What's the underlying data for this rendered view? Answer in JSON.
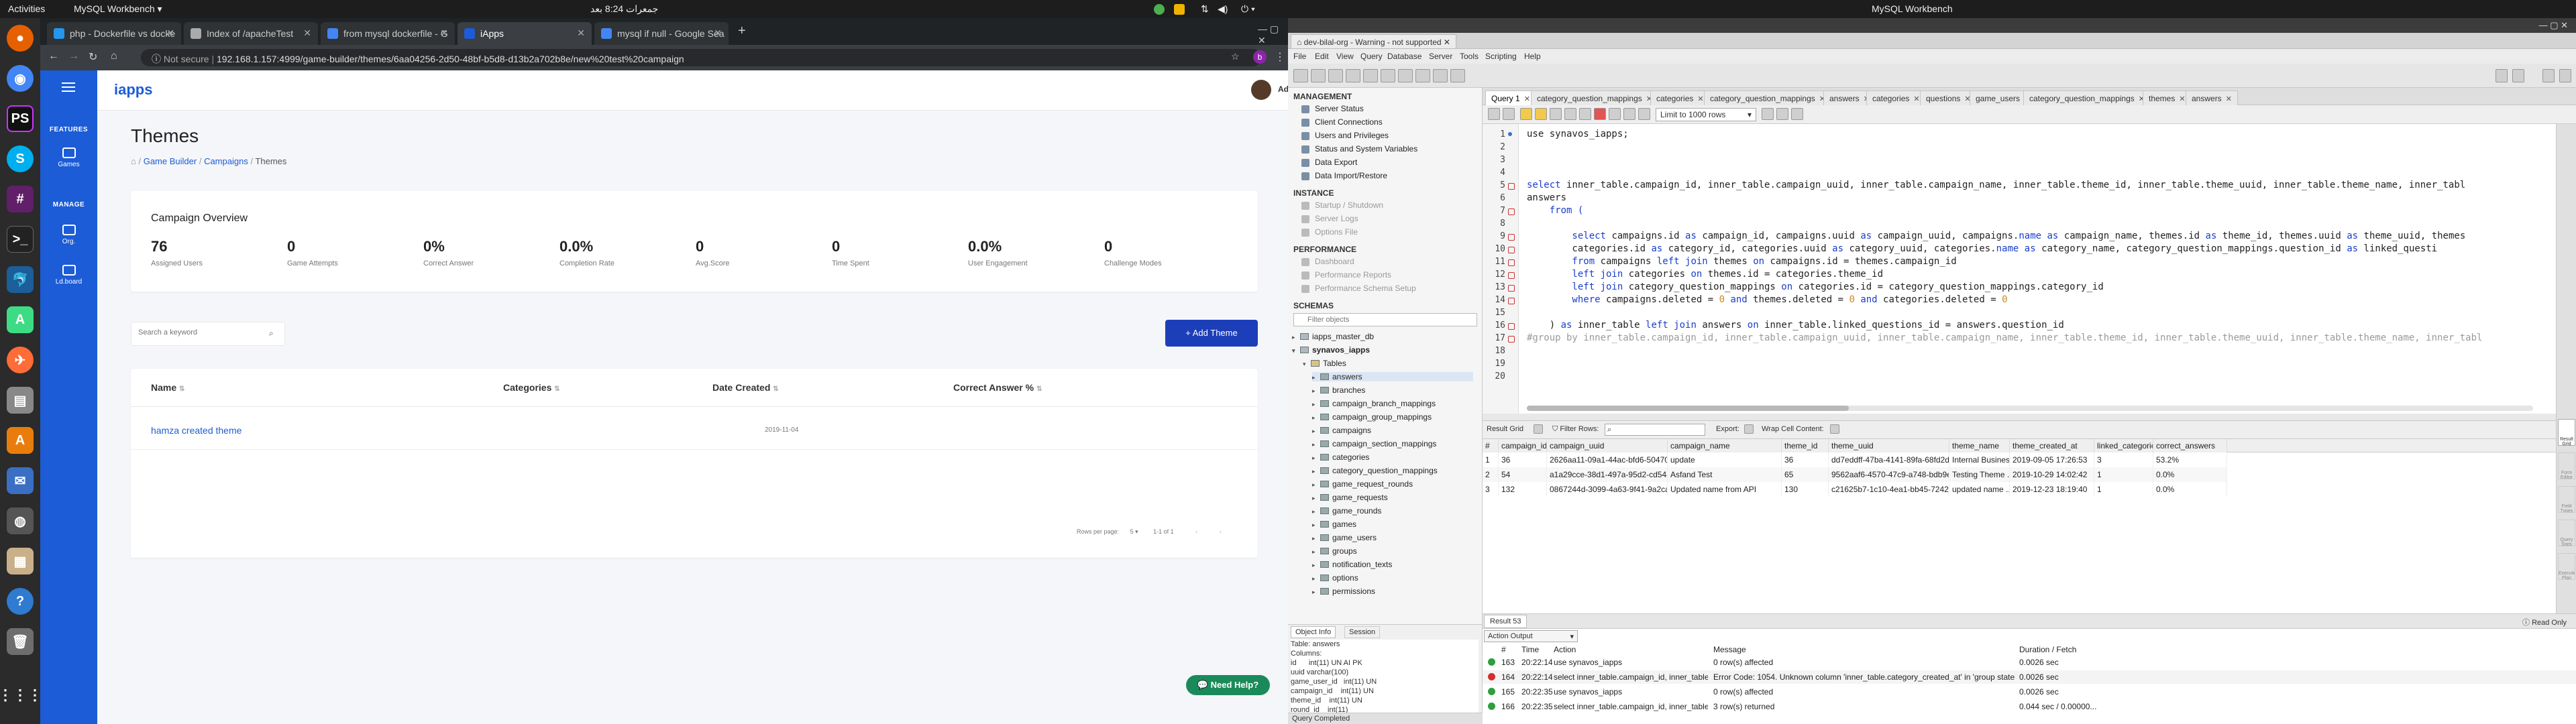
{
  "topbar": {
    "activities": "Activities",
    "app_menu": "MySQL Workbench ▾",
    "clock": "جمعرات 8:24 بعد",
    "wb_title": "MySQL Workbench"
  },
  "chrome": {
    "tabs": [
      {
        "label": "php - Dockerfile vs docke"
      },
      {
        "label": "Index of /apacheTest"
      },
      {
        "label": "from mysql dockerfile - G"
      },
      {
        "label": "iApps"
      },
      {
        "label": "mysql if null - Google Sea"
      }
    ],
    "address_prefix": "Not secure",
    "address": "192.168.1.157:4999/game-builder/themes/6aa04256-2d50-48bf-b5d8-d13b2a702b8e/new%20test%20campaign"
  },
  "app": {
    "brand": "iapps",
    "nav": {
      "features_label": "FEATURES",
      "games_label": "Games",
      "manage_label": "MANAGE",
      "org_label": "Org.",
      "lb_label": "Ld.board"
    },
    "user": {
      "name": "Admin"
    },
    "page_title": "Themes",
    "breadcrumb": [
      "Game Builder",
      "Campaigns",
      "Themes"
    ],
    "overview": {
      "title": "Campaign Overview",
      "stats": [
        {
          "value": "76",
          "label": "Assigned Users"
        },
        {
          "value": "0",
          "label": "Game Attempts"
        },
        {
          "value": "0%",
          "label": "Correct Answer"
        },
        {
          "value": "0.0%",
          "label": "Completion Rate"
        },
        {
          "value": "0",
          "label": "Avg.Score"
        },
        {
          "value": "0",
          "label": "Time Spent"
        },
        {
          "value": "0.0%",
          "label": "User Engagement"
        },
        {
          "value": "0",
          "label": "Challenge Modes"
        }
      ]
    },
    "search_placeholder": "Search a keyword",
    "add_theme_label": "+ Add Theme",
    "table": {
      "headers": [
        "Name",
        "Categories",
        "Date Created",
        "Correct Answer %"
      ],
      "rows": [
        {
          "name": "hamza created theme",
          "categories": "",
          "date": "2019-11-04",
          "correct": ""
        }
      ],
      "pagination": {
        "rows_label": "Rows per page:",
        "rows_value": "5",
        "range": "1-1 of 1"
      }
    },
    "help_label": "Need Help?",
    "brand_color": "#1c5cd6"
  },
  "workbench": {
    "connection_tab": "dev-bilal-org - Warning - not supported",
    "menu": [
      "File",
      "Edit",
      "View",
      "Query",
      "Database",
      "Server",
      "Tools",
      "Scripting",
      "Help"
    ],
    "navigator": {
      "management_title": "MANAGEMENT",
      "management_items": [
        "Server Status",
        "Client Connections",
        "Users and Privileges",
        "Status and System Variables",
        "Data Export",
        "Data Import/Restore"
      ],
      "instance_title": "INSTANCE",
      "instance_items": [
        "Startup / Shutdown",
        "Server Logs",
        "Options File"
      ],
      "performance_title": "PERFORMANCE",
      "performance_items": [
        "Dashboard",
        "Performance Reports",
        "Performance Schema Setup"
      ],
      "schemas_title": "SCHEMAS",
      "filter_placeholder": "Filter objects",
      "schemas": [
        "iapps_master_db",
        "synavos_iapps"
      ],
      "tables_label": "Tables",
      "tables": [
        "answers",
        "branches",
        "campaign_branch_mappings",
        "campaign_group_mappings",
        "campaigns",
        "campaign_section_mappings",
        "categories",
        "category_question_mappings",
        "game_request_rounds",
        "game_requests",
        "game_rounds",
        "games",
        "game_users",
        "groups",
        "notification_texts",
        "options",
        "permissions"
      ]
    },
    "info": {
      "tabs": [
        "Object Info",
        "Session"
      ],
      "lines": [
        "Table: answers",
        "Columns:",
        "id      int(11) UN AI PK",
        "uuid varchar(100)",
        "game_user_id   int(11) UN",
        "campaign_id    int(11) UN",
        "theme_id    int(11) UN",
        "round_id    int(11)"
      ]
    },
    "editor_tabs": [
      "Query 1",
      "category_question_mappings",
      "categories",
      "category_question_mappings",
      "answers",
      "categories",
      "questions",
      "game_users",
      "category_question_mappings",
      "themes",
      "answers"
    ],
    "limit_label": "Limit to 1000 rows",
    "code_lines": [
      [
        {
          "t": "use synavos_iapps;",
          "c": "pl"
        }
      ],
      [],
      [],
      [],
      [
        {
          "t": "select ",
          "c": "kw"
        },
        {
          "t": "inner_table.campaign_id, inner_table.campaign_uuid, inner_table.campaign_name, inner_table.theme_id, inner_table.theme_uuid, inner_table.theme_name, inner_tabl",
          "c": "pl"
        }
      ],
      [
        {
          "t": "answers",
          "c": "pl"
        }
      ],
      [
        {
          "t": "    from (",
          "c": "kw"
        }
      ],
      [],
      [
        {
          "t": "        select ",
          "c": "kw"
        },
        {
          "t": "campaigns.id ",
          "c": "pl"
        },
        {
          "t": "as ",
          "c": "kw"
        },
        {
          "t": "campaign_id, campaigns.uuid ",
          "c": "pl"
        },
        {
          "t": "as ",
          "c": "kw"
        },
        {
          "t": "campaign_uuid, campaigns.",
          "c": "pl"
        },
        {
          "t": "name ",
          "c": "kw"
        },
        {
          "t": "as ",
          "c": "kw"
        },
        {
          "t": "campaign_name, themes.id ",
          "c": "pl"
        },
        {
          "t": "as ",
          "c": "kw"
        },
        {
          "t": "theme_id, themes.uuid ",
          "c": "pl"
        },
        {
          "t": "as ",
          "c": "kw"
        },
        {
          "t": "theme_uuid, themes",
          "c": "pl"
        }
      ],
      [
        {
          "t": "        categories.id ",
          "c": "pl"
        },
        {
          "t": "as ",
          "c": "kw"
        },
        {
          "t": "category_id, categories.uuid ",
          "c": "pl"
        },
        {
          "t": "as ",
          "c": "kw"
        },
        {
          "t": "category_uuid, categories.",
          "c": "pl"
        },
        {
          "t": "name ",
          "c": "kw"
        },
        {
          "t": "as ",
          "c": "kw"
        },
        {
          "t": "category_name, category_question_mappings.question_id ",
          "c": "pl"
        },
        {
          "t": "as ",
          "c": "kw"
        },
        {
          "t": "linked_questi",
          "c": "pl"
        }
      ],
      [
        {
          "t": "        from ",
          "c": "kw"
        },
        {
          "t": "campaigns ",
          "c": "pl"
        },
        {
          "t": "left join ",
          "c": "kw"
        },
        {
          "t": "themes ",
          "c": "pl"
        },
        {
          "t": "on ",
          "c": "kw"
        },
        {
          "t": "campaigns.id = themes.campaign_id",
          "c": "pl"
        }
      ],
      [
        {
          "t": "        left join ",
          "c": "kw"
        },
        {
          "t": "categories ",
          "c": "pl"
        },
        {
          "t": "on ",
          "c": "kw"
        },
        {
          "t": "themes.id = categories.theme_id",
          "c": "pl"
        }
      ],
      [
        {
          "t": "        left join ",
          "c": "kw"
        },
        {
          "t": "category_question_mappings ",
          "c": "pl"
        },
        {
          "t": "on ",
          "c": "kw"
        },
        {
          "t": "categories.id = category_question_mappings.category_id",
          "c": "pl"
        }
      ],
      [
        {
          "t": "        where ",
          "c": "kw"
        },
        {
          "t": "campaigns.deleted = ",
          "c": "pl"
        },
        {
          "t": "0 ",
          "c": "st"
        },
        {
          "t": "and ",
          "c": "kw"
        },
        {
          "t": "themes.deleted = ",
          "c": "pl"
        },
        {
          "t": "0 ",
          "c": "st"
        },
        {
          "t": "and ",
          "c": "kw"
        },
        {
          "t": "categories.deleted = ",
          "c": "pl"
        },
        {
          "t": "0",
          "c": "st"
        }
      ],
      [],
      [
        {
          "t": "    ) ",
          "c": "pl"
        },
        {
          "t": "as ",
          "c": "kw"
        },
        {
          "t": "inner_table ",
          "c": "pl"
        },
        {
          "t": "left join ",
          "c": "kw"
        },
        {
          "t": "answers ",
          "c": "pl"
        },
        {
          "t": "on ",
          "c": "kw"
        },
        {
          "t": "inner_table.linked_questions_id = answers.question_id",
          "c": "pl"
        }
      ],
      [
        {
          "t": "#group by inner_table.campaign_id, inner_table.campaign_uuid, inner_table.campaign_name, inner_table.theme_id, inner_table.theme_uuid, inner_table.theme_name, inner_tabl",
          "c": "cm"
        }
      ],
      [],
      [],
      []
    ],
    "result_bar": {
      "result_grid": "Result Grid",
      "filter_rows": "Filter Rows:",
      "export": "Export:",
      "wrap": "Wrap Cell Content:"
    },
    "grid": {
      "headers": [
        "#",
        "campaign_id",
        "campaign_uuid",
        "campaign_name",
        "theme_id",
        "theme_uuid",
        "theme_name",
        "theme_created_at",
        "linked_categories",
        "correct_answers"
      ],
      "rows": [
        [
          "1",
          "36",
          "2626aa11-09a1-44ac-bfd6-504708...",
          "update",
          "36",
          "dd7eddff-47ba-4141-89fa-68fd2d5...",
          "Internal Business ...",
          "2019-09-05 17:26:53",
          "3",
          "53.2%"
        ],
        [
          "2",
          "54",
          "a1a29cce-38d1-497a-95d2-cd54ab...",
          "Asfand  Test",
          "65",
          "9562aaf6-4570-47c9-a748-bdb9e3...",
          "Testing Theme ...",
          "2019-10-29 14:02:42",
          "1",
          "0.0%"
        ],
        [
          "3",
          "132",
          "0867244d-3099-4a63-9f41-9a2ca5...",
          "Updated name from API",
          "130",
          "c21625b7-1c10-4ea1-bb45-7242d9...",
          "updated name ...",
          "2019-12-23 18:19:40",
          "1",
          "0.0%"
        ]
      ]
    },
    "result_tab": "Result 53",
    "read_only": "Read Only",
    "side_buttons": [
      "Result Grid",
      "Form Editor",
      "Field Types",
      "Query Stats",
      "Execution Plan"
    ],
    "output": {
      "dropdown": "Action Output",
      "headers": [
        "#",
        "Time",
        "Action",
        "Message",
        "Duration / Fetch"
      ],
      "rows": [
        {
          "status": "ok",
          "n": "163",
          "time": "20:22:14",
          "action": "use synavos_iapps",
          "message": "0 row(s) affected",
          "dur": "0.0026 sec"
        },
        {
          "status": "err",
          "n": "164",
          "time": "20:22:14",
          "action": "select inner_table.campaign_id, inner_table.campaign_uuid, in...",
          "message": "Error Code: 1054. Unknown column 'inner_table.category_created_at' in 'group stateme...",
          "dur": "0.0026 sec"
        },
        {
          "status": "ok",
          "n": "165",
          "time": "20:22:35",
          "action": "use synavos_iapps",
          "message": "0 row(s) affected",
          "dur": "0.0026 sec"
        },
        {
          "status": "ok",
          "n": "166",
          "time": "20:22:35",
          "action": "select inner_table.campaign_id, inner_table.campaign_uuid, in...",
          "message": "3 row(s) returned",
          "dur": "0.044 sec / 0.00000..."
        }
      ]
    },
    "status": "Query Completed"
  }
}
